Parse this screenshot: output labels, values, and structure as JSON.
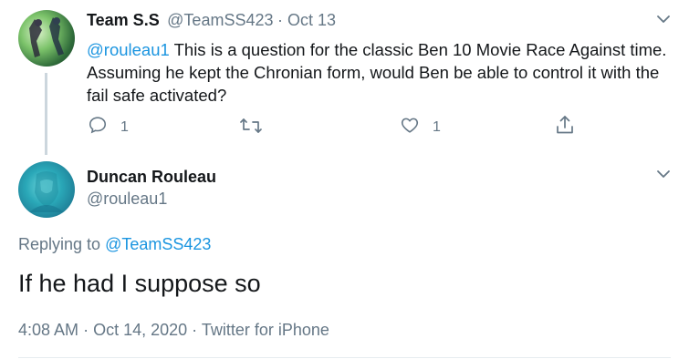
{
  "tweet1": {
    "name": "Team S.S",
    "handle": "@TeamSS423",
    "date": "Oct 13",
    "mention": "@rouleau1",
    "text": " This is a question for the classic Ben 10 Movie Race Against time. Assuming he kept the Chronian form, would Ben be able to control it with the fail safe activated?",
    "reply_count": "1",
    "like_count": "1"
  },
  "tweet2": {
    "name": "Duncan Rouleau",
    "handle": "@rouleau1",
    "replying_prefix": "Replying to ",
    "replying_to": "@TeamSS423",
    "text": "If he had I suppose so",
    "time": "4:08 AM",
    "date": "Oct 14, 2020",
    "source": "Twitter for iPhone"
  },
  "icons": {
    "reply": "reply-icon",
    "retweet": "retweet-icon",
    "like": "heart-icon",
    "share": "share-icon",
    "menu": "chevron-down-icon"
  },
  "colors": {
    "link": "#1b95e0",
    "muted": "#657786",
    "text": "#14171a"
  }
}
